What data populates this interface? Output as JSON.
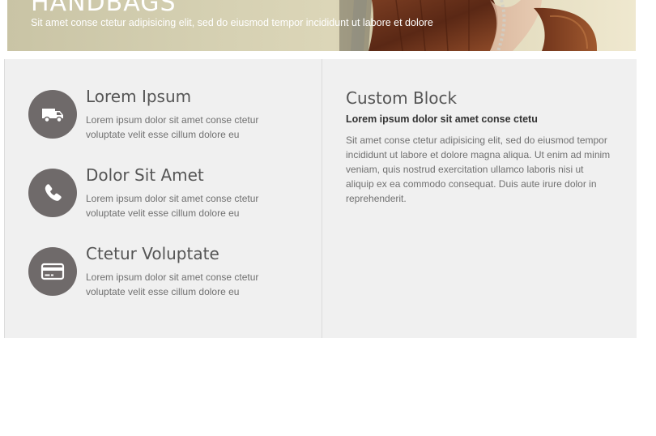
{
  "banner": {
    "title": "HANDBAGS",
    "subtitle": "Sit amet conse ctetur adipisicing elit, sed do eiusmod tempor incididunt ut labore et dolore"
  },
  "features": [
    {
      "icon": "truck-icon",
      "title": "Lorem Ipsum",
      "text": "Lorem ipsum dolor sit amet conse ctetur voluptate velit esse cillum dolore eu"
    },
    {
      "icon": "phone-icon",
      "title": "Dolor Sit Amet",
      "text": "Lorem ipsum dolor sit amet conse ctetur voluptate velit esse cillum dolore eu"
    },
    {
      "icon": "credit-card-icon",
      "title": "Ctetur Voluptate",
      "text": "Lorem ipsum dolor sit amet conse ctetur voluptate velit esse cillum dolore eu"
    }
  ],
  "custom_block": {
    "title": "Custom Block",
    "lead": "Lorem ipsum dolor sit amet conse ctetu",
    "body": "Sit amet conse ctetur adipisicing elit, sed do eiusmod tempor incididunt ut labore et dolore magna aliqua. Ut enim ad minim veniam, quis nostrud exercitation ullamco laboris nisi ut aliquip ex ea commodo consequat. Duis aute irure dolor in reprehenderit."
  },
  "colors": {
    "icon_circle": "#6f6a6a",
    "panel_background": "#f0f0f0",
    "heading_text": "#555555",
    "body_text": "#707070"
  }
}
